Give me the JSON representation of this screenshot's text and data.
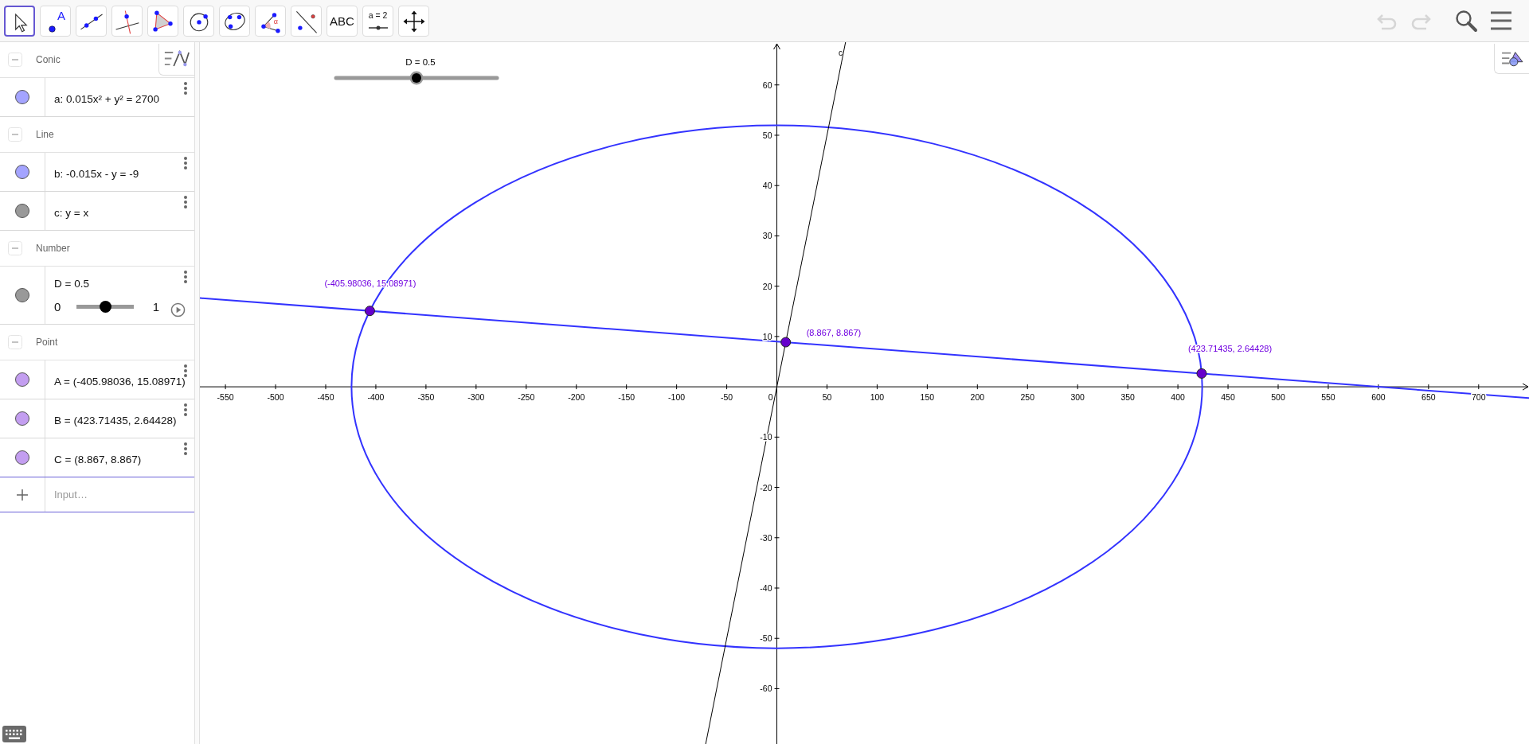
{
  "toolbar": {
    "tools": [
      {
        "kind": "move",
        "selected": true
      },
      {
        "kind": "point",
        "label": "A",
        "selected": false
      },
      {
        "kind": "line",
        "selected": false
      },
      {
        "kind": "perpendicular",
        "selected": false
      },
      {
        "kind": "polygon",
        "selected": false
      },
      {
        "kind": "circle",
        "selected": false
      },
      {
        "kind": "conic",
        "selected": false
      },
      {
        "kind": "angle",
        "label": "α",
        "selected": false
      },
      {
        "kind": "reflect",
        "selected": false
      },
      {
        "kind": "text",
        "label": "ABC",
        "selected": false
      },
      {
        "kind": "slider",
        "label": "a = 2",
        "selected": false
      },
      {
        "kind": "pan",
        "selected": false
      }
    ],
    "undo": {
      "disabled": true
    },
    "redo": {
      "disabled": true
    }
  },
  "algebra": {
    "groups": [
      {
        "title": "Conic",
        "expanded": true,
        "items": [
          {
            "kind": "formula",
            "text": "a: 0.015x² + y² = 2700",
            "color": "#a4a4ff"
          }
        ]
      },
      {
        "title": "Line",
        "expanded": true,
        "items": [
          {
            "kind": "formula",
            "text": "b: -0.015x - y = -9",
            "color": "#a4a4ff"
          },
          {
            "kind": "formula",
            "text": "c: y = x",
            "color": "#999999"
          }
        ]
      },
      {
        "title": "Number",
        "expanded": true,
        "items": [
          {
            "kind": "slider",
            "text": "D = 0.5",
            "color": "#999999",
            "min": "0",
            "max": "1",
            "level": 0.5
          }
        ]
      },
      {
        "title": "Point",
        "expanded": true,
        "items": [
          {
            "kind": "formula",
            "text": "A = (-405.98036, 15.08971)",
            "color": "#c39ef0"
          },
          {
            "kind": "formula",
            "text": "B = (423.71435, 2.64428)",
            "color": "#c39ef0"
          },
          {
            "kind": "formula",
            "text": "C = (8.867, 8.867)",
            "color": "#c39ef0"
          }
        ]
      }
    ],
    "input": {
      "placeholder": "Input…"
    }
  },
  "graphics": {
    "xtick_labels": [
      "-550",
      "-500",
      "-450",
      "-400",
      "-350",
      "-300",
      "-250",
      "-200",
      "-150",
      "-100",
      "-50",
      "0",
      "50",
      "100",
      "150",
      "200",
      "250",
      "300",
      "350",
      "400",
      "450",
      "500",
      "550",
      "600",
      "650",
      "700"
    ],
    "ytick_labels": [
      "60",
      "50",
      "40",
      "30",
      "20",
      "10",
      "-10",
      "-20",
      "-30",
      "-40",
      "-50",
      "-60"
    ],
    "curves": [
      {
        "kind": "ellipse",
        "color": "#3333ff"
      },
      {
        "kind": "line",
        "color": "#3333ff"
      },
      {
        "kind": "line",
        "color": "#000000",
        "label": "c"
      }
    ],
    "points": [
      {
        "label": "(-405.98036, 15.08971)"
      },
      {
        "label": "(423.71435, 2.64428)"
      },
      {
        "label": "(8.867, 8.867)"
      }
    ],
    "slider": {
      "label": "D = 0.5",
      "level": 0.5
    }
  }
}
